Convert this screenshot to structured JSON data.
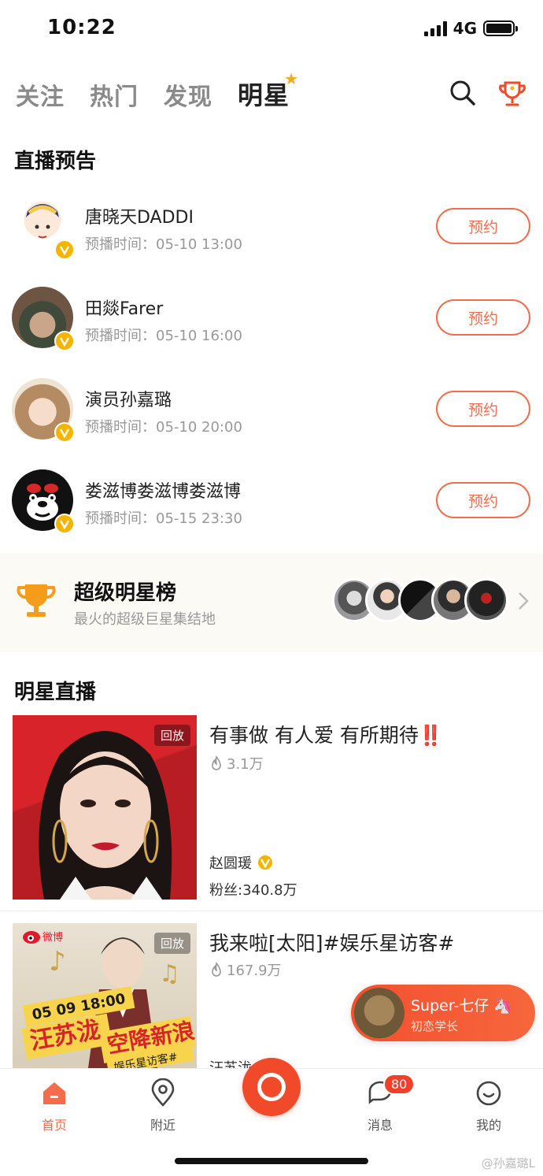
{
  "status_bar": {
    "time": "10:22",
    "network": "4G"
  },
  "top_tabs": [
    {
      "label": "关注"
    },
    {
      "label": "热门"
    },
    {
      "label": "发现"
    },
    {
      "label": "明星"
    }
  ],
  "sections": {
    "live_preview_title": "直播预告",
    "star_live_title": "明星直播"
  },
  "live_preview": [
    {
      "name": "唐晓天DADDI",
      "time": "预播时间：05-10 13:00",
      "button": "预约"
    },
    {
      "name": "田燚Farer",
      "time": "预播时间：05-10 16:00",
      "button": "预约"
    },
    {
      "name": "演员孙嘉璐",
      "time": "预播时间：05-10 20:00",
      "button": "预约"
    },
    {
      "name": "娄滋博娄滋博娄滋博",
      "time": "预播时间：05-15 23:30",
      "button": "预约"
    }
  ],
  "super_star": {
    "title": "超级明星榜",
    "subtitle": "最火的超级巨星集结地"
  },
  "star_live": [
    {
      "title": "有事做 有人爱 有所期待‼️",
      "views": "3.1万",
      "tag": "回放",
      "host": "赵圆瑗",
      "fans": "粉丝:340.8万"
    },
    {
      "title": "我来啦[太阳]#娱乐星访客#",
      "views": "167.9万",
      "tag": "回放",
      "host": "汪苏泷",
      "poster_brand": "微博",
      "poster_date": "05 09 18:00",
      "poster_name": "汪苏泷",
      "poster_slogan": "空降新浪",
      "poster_tag": "娱乐星访客#"
    }
  ],
  "float_pill": {
    "name": "Super-七仔 🦄",
    "subtitle": "初恋学长"
  },
  "bottom_nav": [
    {
      "label": "首页"
    },
    {
      "label": "附近"
    },
    {
      "label": "消息",
      "badge": "80"
    },
    {
      "label": "我的"
    }
  ],
  "watermark": "@孙嘉璐L",
  "colors": {
    "accent": "#f36c4c",
    "gold": "#f5b400",
    "record": "#f04a2b"
  }
}
